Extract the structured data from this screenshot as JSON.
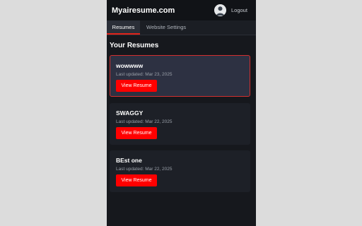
{
  "header": {
    "brand": "Myairesume.com",
    "logout_label": "Logout"
  },
  "tabs": [
    {
      "label": "Resumes",
      "active": true
    },
    {
      "label": "Website Settings",
      "active": false
    }
  ],
  "main": {
    "section_title": "Your Resumes",
    "resumes": [
      {
        "title": "wowwww",
        "updated": "Last updated: Mar 23, 2025",
        "button_label": "View Resume",
        "selected": true
      },
      {
        "title": "SWAGGY",
        "updated": "Last updated: Mar 22, 2025",
        "button_label": "View Resume",
        "selected": false
      },
      {
        "title": "BEst one",
        "updated": "Last updated: Mar 22, 2025",
        "button_label": "View Resume",
        "selected": false
      }
    ]
  },
  "colors": {
    "accent": "#ff0000",
    "selected_border": "#d32f2f",
    "panel_bg": "#16181d",
    "card_bg": "#1d2027",
    "selected_card_bg": "#2d3142"
  },
  "icons": {
    "avatar": "user-avatar"
  }
}
